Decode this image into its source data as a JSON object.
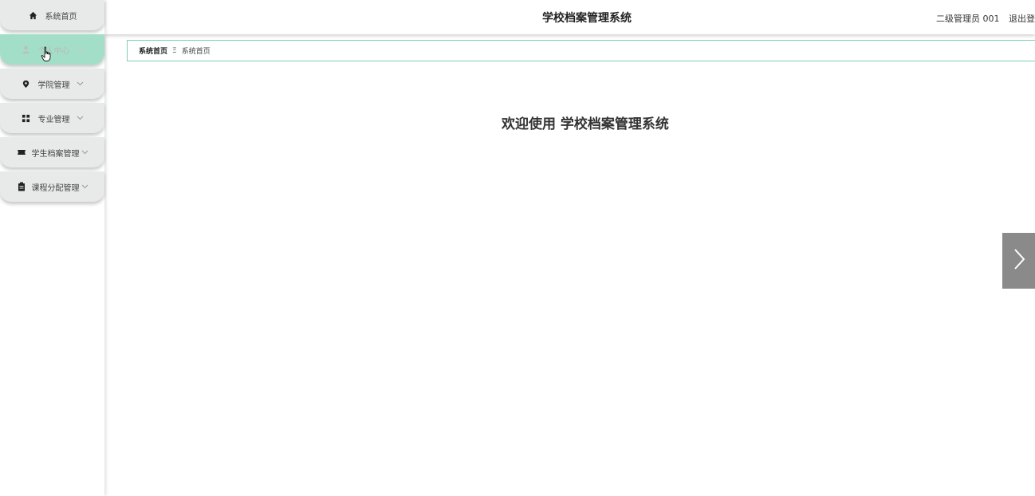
{
  "sidebar": {
    "items": [
      {
        "label": "系统首页",
        "icon": "home-icon",
        "has_arrow": false
      },
      {
        "label": "个人中心",
        "icon": "user-icon",
        "has_arrow": true,
        "active": true
      },
      {
        "label": "学院管理",
        "icon": "location-pin-icon",
        "has_arrow": true
      },
      {
        "label": "专业管理",
        "icon": "grid-icon",
        "has_arrow": true
      },
      {
        "label": "学生档案管理",
        "icon": "ticket-icon",
        "has_arrow": true
      },
      {
        "label": "课程分配管理",
        "icon": "clipboard-icon",
        "has_arrow": true
      }
    ]
  },
  "header": {
    "title": "学校档案管理系统",
    "user_label": "二级管理员 001",
    "logout_label": "退出登"
  },
  "breadcrumb": {
    "current": "系统首页",
    "separator": "Ξ",
    "link": "系统首页"
  },
  "main": {
    "welcome": "欢迎使用 学校档案管理系统"
  },
  "colors": {
    "accent": "#7fcfb1",
    "active_menu_bg": "#a3dfc8",
    "menu_bg": "#e8eaea",
    "next_button_bg": "#8a8a8a"
  }
}
